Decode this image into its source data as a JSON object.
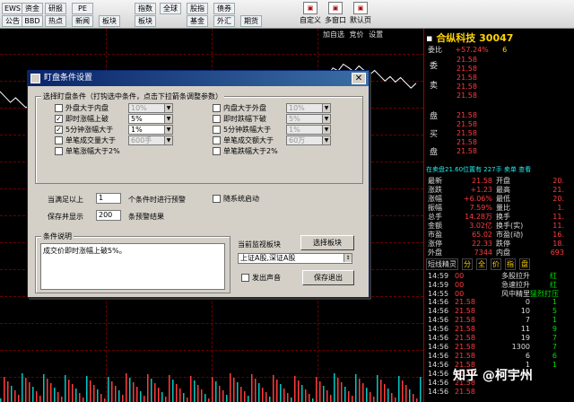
{
  "toolbar": {
    "row1": [
      "EWS",
      "资金",
      "研报",
      "PE",
      "指数",
      "全球",
      "股指",
      "债券"
    ],
    "row2": [
      "公告",
      "BBD",
      "热点",
      "新闻",
      "板块",
      "板块",
      "基金",
      "外汇",
      "期货"
    ],
    "big_buttons": [
      {
        "label": "自定义",
        "icon": "custom-icon"
      },
      {
        "label": "多窗口",
        "icon": "multi-window-icon"
      },
      {
        "label": "默认页",
        "icon": "home-icon"
      }
    ]
  },
  "chart_topbar": [
    "加自选",
    "竞价",
    "设置"
  ],
  "stock": {
    "name": "合纵科技",
    "code": "30047"
  },
  "orderbook": {
    "header_label": "委比",
    "header_value": "+57.24%",
    "header_vol": "6",
    "asks": [
      {
        "price": "21.58",
        "vol": ""
      },
      {
        "price": "21.58",
        "vol": ""
      },
      {
        "price": "21.58",
        "vol": ""
      },
      {
        "price": "21.58",
        "vol": ""
      },
      {
        "price": "21.58",
        "vol": ""
      }
    ],
    "bids": [
      {
        "price": "21.58",
        "vol": ""
      },
      {
        "price": "21.58",
        "vol": ""
      },
      {
        "price": "21.58",
        "vol": ""
      },
      {
        "price": "21.58",
        "vol": ""
      },
      {
        "price": "21.58",
        "vol": ""
      }
    ],
    "side_labels": [
      "委",
      "卖",
      "盘",
      "买",
      "盘"
    ]
  },
  "summary_line": "在卖盘21.60位置有 227手  卖单 查看",
  "quotes": [
    {
      "l": "最新",
      "v": "21.58",
      "l2": "开盘",
      "v2": "20."
    },
    {
      "l": "涨跌",
      "v": "+1.23",
      "l2": "最高",
      "v2": "21."
    },
    {
      "l": "涨幅",
      "v": "+6.06%",
      "l2": "最低",
      "v2": "20."
    },
    {
      "l": "振幅",
      "v": "7.59%",
      "l2": "量比",
      "v2": "1."
    },
    {
      "l": "总手",
      "v": "14.28万",
      "l2": "换手",
      "v2": "11."
    },
    {
      "l": "金额",
      "v": "3.02亿",
      "l2": "换手(实)",
      "v2": "11."
    },
    {
      "l": "市盈",
      "v": "65.02",
      "l2": "市盈(动)",
      "v2": "16."
    },
    {
      "l": "涨停",
      "v": "22.33",
      "l2": "跌停",
      "v2": "18."
    },
    {
      "l": "外盘",
      "v": "7344",
      "l2": "内盘",
      "v2": "693"
    }
  ],
  "tabs": [
    "短线精灵",
    "分",
    "全",
    "价",
    "指",
    "盘"
  ],
  "ticks": [
    {
      "t": "14:59",
      "p": "00",
      "v": "多股拉升",
      "c": "红"
    },
    {
      "t": "14:59",
      "p": "00",
      "v": "急速拉升",
      "c": "红"
    },
    {
      "t": "14:55",
      "p": "00",
      "v": "风中精里",
      "c": "猛烈打压"
    },
    {
      "t": "14:56",
      "p": "21.58",
      "v": "0",
      "c": "1"
    },
    {
      "t": "14:56",
      "p": "21.58",
      "v": "10",
      "c": "5"
    },
    {
      "t": "14:56",
      "p": "21.58",
      "v": "7",
      "c": "1"
    },
    {
      "t": "14:56",
      "p": "21.58",
      "v": "11",
      "c": "9"
    },
    {
      "t": "14:56",
      "p": "21.58",
      "v": "19",
      "c": "7"
    },
    {
      "t": "14:56",
      "p": "21.58",
      "v": "1300",
      "c": "7"
    },
    {
      "t": "14:56",
      "p": "21.58",
      "v": "6",
      "c": "6"
    },
    {
      "t": "14:56",
      "p": "21.58",
      "v": "1",
      "c": "1"
    },
    {
      "t": "14:56",
      "p": "21.58",
      "v": "",
      "c": ""
    },
    {
      "t": "14:56",
      "p": "21.58",
      "v": "",
      "c": ""
    },
    {
      "t": "14:56",
      "p": "21.58",
      "v": "",
      "c": ""
    }
  ],
  "dialog": {
    "title": "盯盘条件设置",
    "close": "✕",
    "group1_title": "选择盯盘条件（打钩选中条件，点击下拉箭条调整参数）",
    "left_conditions": [
      {
        "label": "外盘大于内盘",
        "checked": false,
        "value": "10%",
        "enabled": false
      },
      {
        "label": "即时涨幅上破",
        "checked": true,
        "value": "5%",
        "enabled": true
      },
      {
        "label": "5分钟涨幅大于",
        "checked": true,
        "value": "1%",
        "enabled": true
      },
      {
        "label": "单笔成交量大于",
        "checked": false,
        "value": "600手",
        "enabled": false
      },
      {
        "label": "单笔涨幅大于2%",
        "checked": false,
        "value": "",
        "enabled": false
      }
    ],
    "right_conditions": [
      {
        "label": "内盘大于外盘",
        "checked": false,
        "value": "10%",
        "enabled": false
      },
      {
        "label": "即时跌幅下破",
        "checked": false,
        "value": "5%",
        "enabled": false
      },
      {
        "label": "5分钟跌幅大于",
        "checked": false,
        "value": "1%",
        "enabled": false
      },
      {
        "label": "单笔成交额大于",
        "checked": false,
        "value": "60万",
        "enabled": false
      },
      {
        "label": "单笔跌幅大于2%",
        "checked": false,
        "value": "",
        "enabled": false
      }
    ],
    "satisfy_label": "当满足以上",
    "satisfy_value": "1",
    "satisfy_suffix": "个条件时进行预警",
    "autostart_label": "随系统启动",
    "save_label": "保存并显示",
    "save_value": "200",
    "save_suffix": "条预警结果",
    "group2_title": "条件说明",
    "description": "成交价即时涨幅上破5%。",
    "monitor_label": "当前监视板块",
    "select_button": "选择板块",
    "board_value": "上证A股,深证A股",
    "sound_label": "发出声音",
    "save_exit_button": "保存退出"
  }
}
